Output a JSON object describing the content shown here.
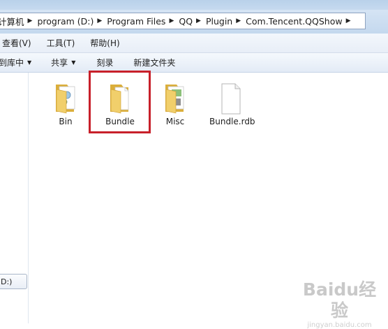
{
  "address_bar": {
    "crumbs": [
      "计算机",
      "program (D:)",
      "Program Files",
      "QQ",
      "Plugin",
      "Com.Tencent.QQShow"
    ]
  },
  "menu": {
    "items": [
      "查看(V)",
      "工具(T)",
      "帮助(H)"
    ]
  },
  "toolbar": {
    "include_in_library": "到库中",
    "share": "共享",
    "burn": "刻录",
    "new_folder": "新建文件夹"
  },
  "nav_pane": {
    "drive_label": "D:)"
  },
  "files": [
    {
      "name": "Bin",
      "type": "folder"
    },
    {
      "name": "Bundle",
      "type": "folder",
      "highlighted": true
    },
    {
      "name": "Misc",
      "type": "folder"
    },
    {
      "name": "Bundle.rdb",
      "type": "file"
    }
  ],
  "watermark": {
    "logo": "Baidu经验",
    "url": "jingyan.baidu.com"
  },
  "colors": {
    "highlight_border": "#c8202a",
    "folder_main": "#f1cf6b",
    "folder_dark": "#dbae3a"
  }
}
